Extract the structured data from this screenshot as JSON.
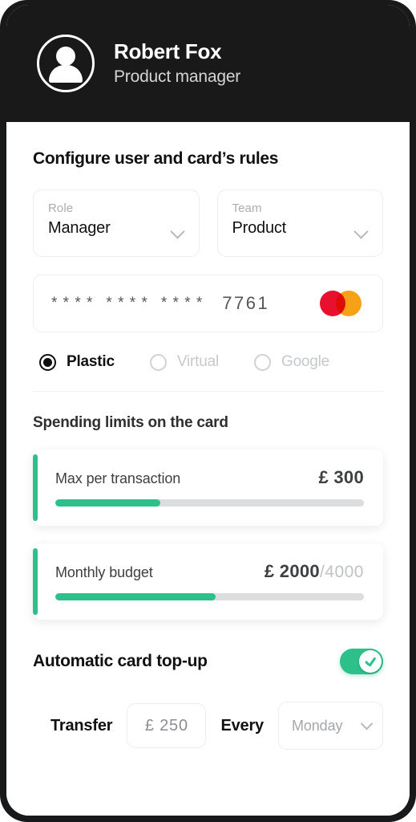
{
  "header": {
    "avatar_icon": "user-avatar-icon",
    "name": "Robert Fox",
    "role": "Product manager"
  },
  "main": {
    "title": "Configure user and card’s rules",
    "selects": [
      {
        "label": "Role",
        "value": "Manager",
        "icon": "chevron-down-icon"
      },
      {
        "label": "Team",
        "value": "Product",
        "icon": "chevron-down-icon"
      }
    ],
    "card": {
      "group1": "* * * *",
      "group2": "* * * *",
      "group3": "* * * *",
      "last4": "7761",
      "brand_icon": "mastercard-logo",
      "brand_colors": {
        "red": "#e8102c",
        "amber": "#f6a118"
      }
    },
    "card_types": [
      {
        "label": "Plastic",
        "selected": true
      },
      {
        "label": "Virtual",
        "selected": false
      },
      {
        "label": "Google",
        "selected": false
      }
    ],
    "limits_title": "Spending limits on the card",
    "limits": [
      {
        "caption": "Max per transaction",
        "amount": "£ 300",
        "max": "",
        "percent": 34,
        "accent": "#2ec08b"
      },
      {
        "caption": "Monthly budget",
        "amount": "£ 2000",
        "max": "/4000",
        "percent": 52,
        "accent": "#2ec08b"
      }
    ],
    "topup": {
      "title": "Automatic card top-up",
      "toggle_on": true,
      "toggle_icon": "check-icon",
      "transfer_label": "Transfer",
      "transfer_amount": "£ 250",
      "every_label": "Every",
      "day_value": "Monday",
      "day_icon": "chevron-down-icon"
    }
  },
  "theme": {
    "accent_green": "#2ec08b",
    "header_bg": "#191919",
    "text_dark": "#111111"
  }
}
